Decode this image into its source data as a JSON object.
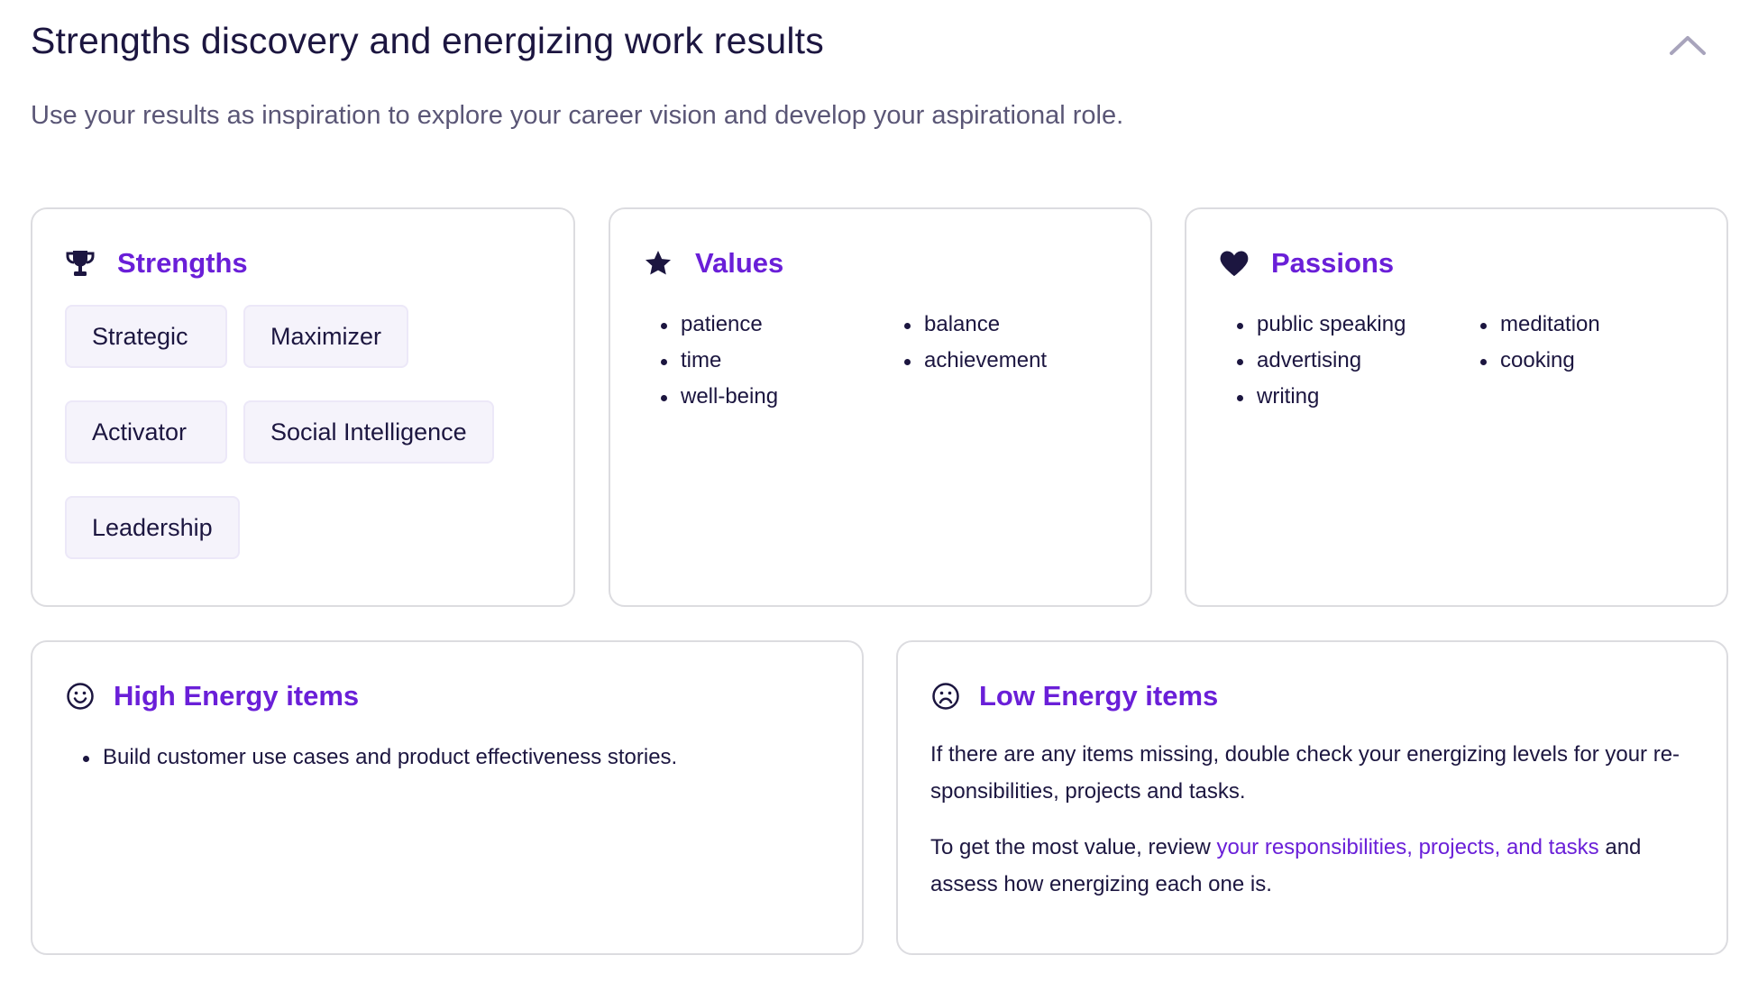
{
  "header": {
    "title": "Strengths discovery and energizing work results",
    "subtitle": "Use your results as inspiration to explore your career vision and develop your aspirational role.",
    "collapse_icon": "chevron-up-icon"
  },
  "colors": {
    "accent": "#6a1fd8",
    "text": "#1c1640",
    "muted": "#5a5676",
    "chip_bg": "#f5f3fb",
    "card_border": "#dcdce0"
  },
  "strengths": {
    "icon": "trophy-icon",
    "title": "Strengths",
    "chips": [
      "Strategic",
      "Maximizer",
      "Activator",
      "Social Intelligence",
      "Leadership"
    ]
  },
  "values": {
    "icon": "star-icon",
    "title": "Values",
    "col1": [
      "patience",
      "time",
      "well-being"
    ],
    "col2": [
      "balance",
      "achievement"
    ]
  },
  "passions": {
    "icon": "heart-icon",
    "title": "Passions",
    "col1": [
      "public speaking",
      "advertising",
      "writing"
    ],
    "col2": [
      "meditation",
      "cooking"
    ]
  },
  "high_energy": {
    "icon": "smile-icon",
    "title": "High Energy items",
    "items": [
      "Build customer use cases and product effectiveness stories."
    ]
  },
  "low_energy": {
    "icon": "frown-icon",
    "title": "Low Energy items",
    "paragraph1": "If there are any items missing, double check your energizing levels for your re-sponsibilities, projects and tasks.",
    "paragraph2_before": "To get the most value, review ",
    "paragraph2_link": "your responsibilities, projects, and tasks",
    "paragraph2_after": " and assess how energizing each one is."
  }
}
